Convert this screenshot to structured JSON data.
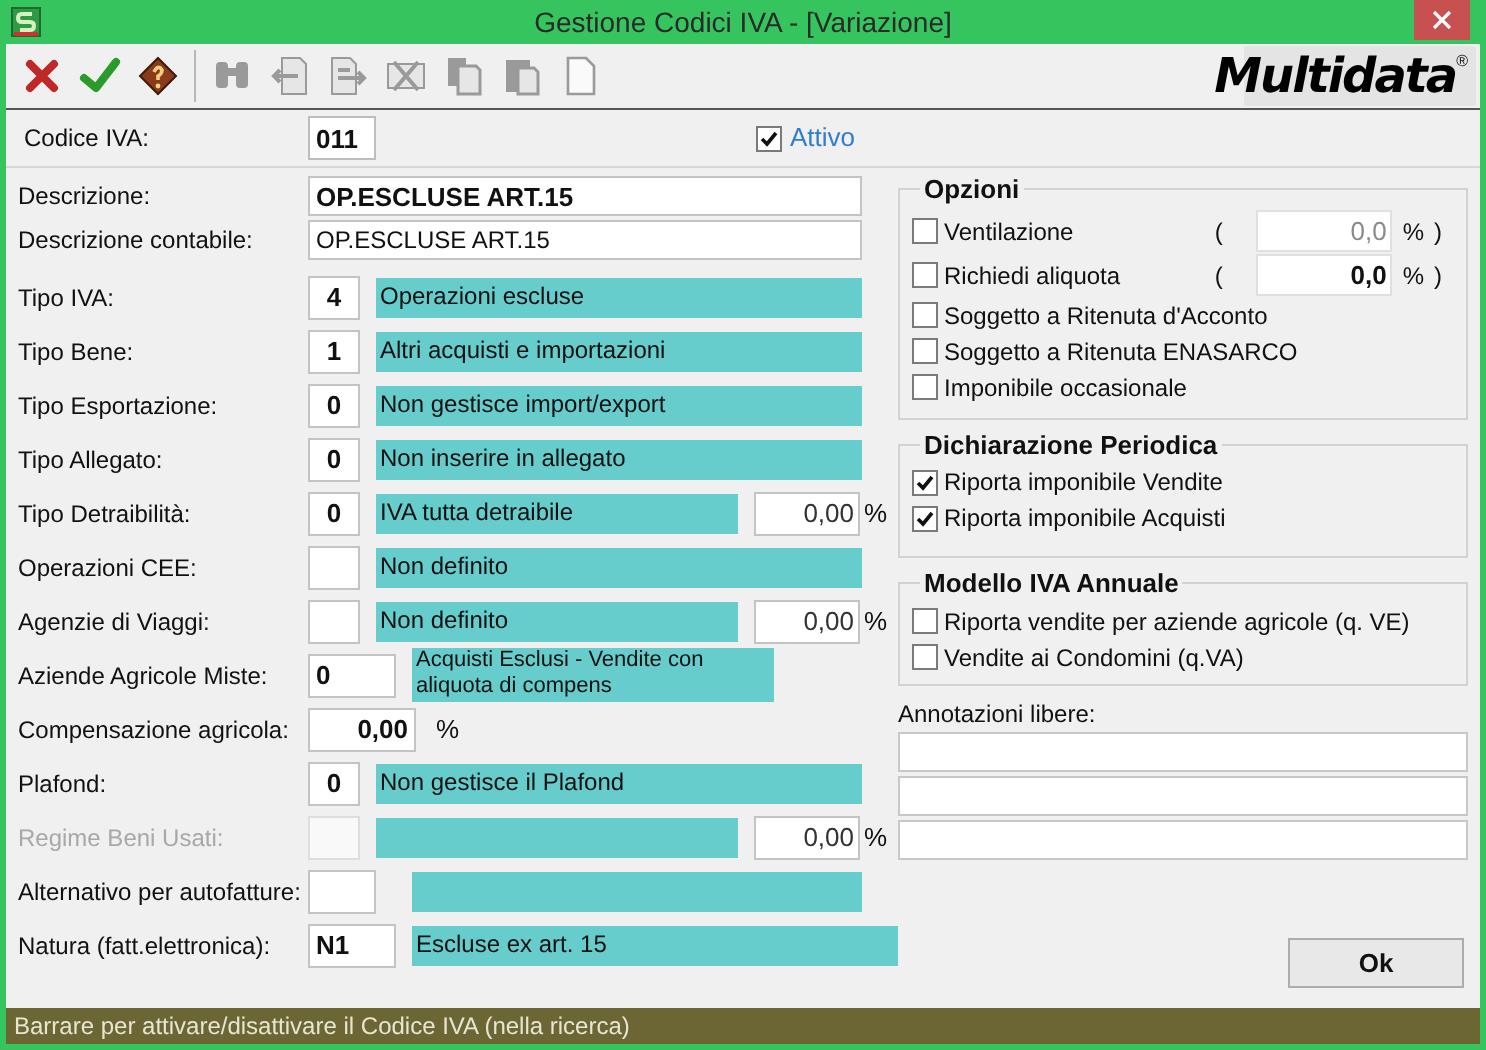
{
  "window": {
    "title": "Gestione Codici IVA - [Variazione]"
  },
  "toolbar": [
    {
      "kind": "cancel",
      "disabled": false
    },
    {
      "kind": "confirm",
      "disabled": false
    },
    {
      "kind": "help",
      "disabled": false
    },
    {
      "kind": "find",
      "disabled": true
    },
    {
      "kind": "previous",
      "disabled": true
    },
    {
      "kind": "next",
      "disabled": true
    },
    {
      "kind": "delete",
      "disabled": true
    },
    {
      "kind": "copy",
      "disabled": true
    },
    {
      "kind": "paste",
      "disabled": true
    },
    {
      "kind": "new",
      "disabled": true
    }
  ],
  "logo": {
    "text": "Multidata",
    "mark": "®"
  },
  "code": {
    "label": "Codice IVA:",
    "value": "011"
  },
  "active": {
    "label": "Attivo",
    "checked": true
  },
  "fields": [
    {
      "kind": "description",
      "label": "Descrizione:",
      "value": "OP.ESCLUSE ART.15"
    },
    {
      "kind": "text",
      "label": "Descrizione contabile:",
      "value": "OP.ESCLUSE ART.15"
    },
    {
      "kind": "coded",
      "label": "Tipo IVA:",
      "code": "4",
      "description": "Operazioni escluse",
      "disabled": false
    },
    {
      "kind": "coded",
      "label": "Tipo Bene:",
      "code": "1",
      "description": "Altri acquisti e importazioni",
      "disabled": false
    },
    {
      "kind": "coded",
      "label": "Tipo Esportazione:",
      "code": "0",
      "description": "Non gestisce import/export",
      "disabled": false
    },
    {
      "kind": "coded",
      "label": "Tipo Allegato:",
      "code": "0",
      "description": "Non inserire in allegato",
      "disabled": false
    },
    {
      "kind": "coded",
      "label": "Tipo Detraibilità:",
      "code": "0",
      "description": "IVA tutta detraibile",
      "percent": "0,00",
      "unit": "%",
      "disabled": false
    },
    {
      "kind": "coded",
      "label": "Operazioni CEE:",
      "description": "Non definito",
      "disabled": false
    },
    {
      "kind": "coded",
      "label": "Agenzie di Viaggi:",
      "description": "Non definito",
      "percent": "0,00",
      "unit": "%",
      "disabled": false
    },
    {
      "kind": "coded_tall",
      "label": "Aziende Agricole Miste:",
      "code": "0",
      "description": "Acquisti Esclusi - Vendite con aliquota di compens",
      "disabled": false
    },
    {
      "kind": "percent",
      "label": "Compensazione agricola:",
      "value": "0,00",
      "unit": "%"
    },
    {
      "kind": "coded",
      "label": "Plafond:",
      "code": "0",
      "description": "Non gestisce il Plafond",
      "disabled": false
    },
    {
      "kind": "coded",
      "label": "Regime Beni Usati:",
      "percent": "0,00",
      "unit": "%",
      "disabled": true
    },
    {
      "kind": "coded_wide",
      "label": "Alternativo per autofatture:",
      "disabled": false
    },
    {
      "kind": "coded_long",
      "label": "Natura (fatt.elettronica):",
      "code": "N1",
      "description": "Escluse ex art. 15",
      "disabled": false
    }
  ],
  "options": {
    "title": "Opzioni",
    "items": [
      {
        "label": "Ventilazione",
        "checked": false,
        "percent": {
          "open": "(",
          "value": "0,0",
          "unit": "%",
          "close": ")",
          "disabled": true
        }
      },
      {
        "label": "Richiedi aliquota",
        "checked": false,
        "percent": {
          "open": "(",
          "value": "0,0",
          "unit": "%",
          "close": ")",
          "disabled": false
        }
      },
      {
        "label": "Soggetto a Ritenuta d'Acconto",
        "checked": false
      },
      {
        "label": "Soggetto a Ritenuta ENASARCO",
        "checked": false
      },
      {
        "label": "Imponibile occasionale",
        "checked": false
      }
    ]
  },
  "periodic": {
    "title": "Dichiarazione Periodica",
    "items": [
      {
        "label": "Riporta imponibile Vendite",
        "checked": true
      },
      {
        "label": "Riporta imponibile Acquisti",
        "checked": true
      }
    ]
  },
  "annual": {
    "title": "Modello IVA Annuale",
    "items": [
      {
        "label": "Riporta vendite per aziende agricole (q. VE)",
        "checked": false
      },
      {
        "label": "Vendite ai Condomini (q.VA)",
        "checked": false
      }
    ]
  },
  "notes": {
    "label": "Annotazioni libere:",
    "lines": [
      {
        "kind": "line"
      },
      {
        "kind": "line"
      },
      {
        "kind": "line"
      }
    ]
  },
  "ok_button": "Ok",
  "status_bar": "Barrare per attivare/disattivare il Codice IVA (nella ricerca)"
}
